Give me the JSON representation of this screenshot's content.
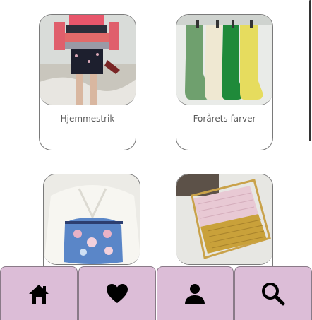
{
  "cards": [
    {
      "title": "Hjemmestrik"
    },
    {
      "title": "Forårets farver"
    },
    {
      "title": ""
    },
    {
      "title": ""
    }
  ],
  "nav": {
    "items": [
      {
        "icon": "home-icon"
      },
      {
        "icon": "heart-icon"
      },
      {
        "icon": "person-icon"
      },
      {
        "icon": "search-icon"
      }
    ],
    "bg_color": "#dcbdd7"
  }
}
